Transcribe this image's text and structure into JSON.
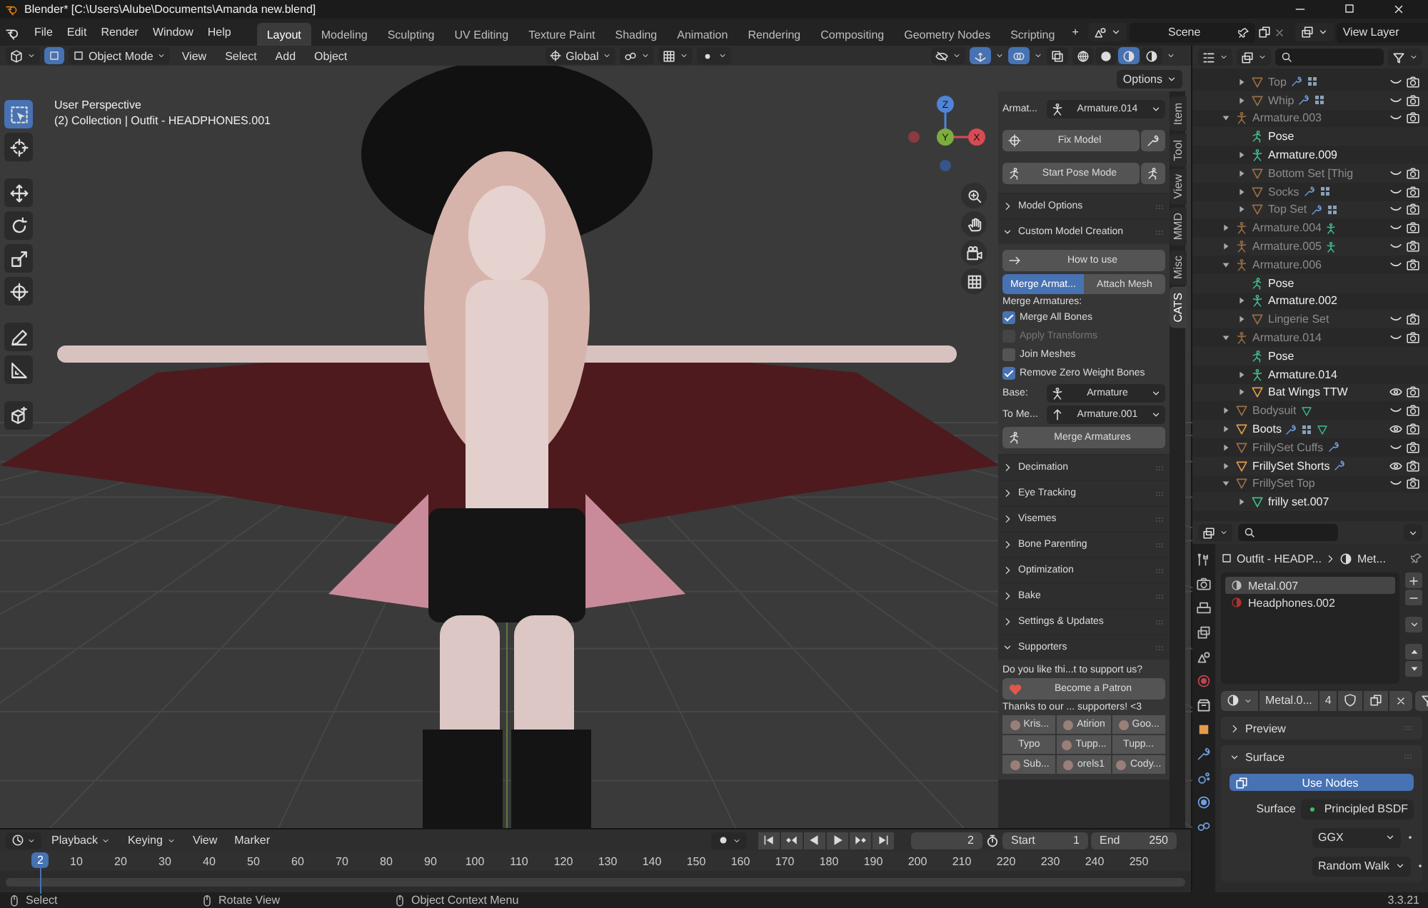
{
  "window": {
    "title": "Blender* [C:\\Users\\Alube\\Documents\\Amanda new.blend]"
  },
  "menu": [
    "File",
    "Edit",
    "Render",
    "Window",
    "Help"
  ],
  "workspaces": [
    {
      "label": "Layout",
      "selected": true
    },
    {
      "label": "Modeling",
      "selected": false
    },
    {
      "label": "Sculpting",
      "selected": false
    },
    {
      "label": "UV Editing",
      "selected": false
    },
    {
      "label": "Texture Paint",
      "selected": false
    },
    {
      "label": "Shading",
      "selected": false
    },
    {
      "label": "Animation",
      "selected": false
    },
    {
      "label": "Rendering",
      "selected": false
    },
    {
      "label": "Compositing",
      "selected": false
    },
    {
      "label": "Geometry Nodes",
      "selected": false
    },
    {
      "label": "Scripting",
      "selected": false
    }
  ],
  "add_workspace": "+",
  "scene": "Scene",
  "view_layer": "View Layer",
  "viewport": {
    "mode": "Object Mode",
    "menus": [
      "View",
      "Select",
      "Add",
      "Object"
    ],
    "orientation": "Global",
    "shading": [
      {
        "kind": "wireframe",
        "selected": false
      },
      {
        "kind": "solid",
        "selected": false
      },
      {
        "kind": "material",
        "selected": true
      },
      {
        "kind": "rendered",
        "selected": false
      }
    ],
    "overlay_text": [
      "User Perspective",
      "(2) Collection | Outfit - HEADPHONES.001"
    ],
    "axis_labels": [
      "Z",
      "Y",
      "X"
    ],
    "tools": [
      {
        "kind": "select-box",
        "selected": true
      },
      {
        "kind": "cursor",
        "selected": false
      },
      {
        "kind": "move",
        "selected": false
      },
      {
        "kind": "rotate",
        "selected": false
      },
      {
        "kind": "scale",
        "selected": false
      },
      {
        "kind": "transform",
        "selected": false
      },
      {
        "kind": "annotate",
        "selected": false
      },
      {
        "kind": "measure",
        "selected": false
      },
      {
        "kind": "add-cube",
        "selected": false
      }
    ]
  },
  "sidebar": {
    "options": "Options",
    "tabs": [
      {
        "label": "Item",
        "selected": false
      },
      {
        "label": "Tool",
        "selected": false
      },
      {
        "label": "View",
        "selected": false
      },
      {
        "label": "MMD",
        "selected": false
      },
      {
        "label": "Misc",
        "selected": false
      },
      {
        "label": "CATS",
        "selected": true
      }
    ],
    "armature_label": "Armat...",
    "armature": "Armature.014",
    "fix_model": "Fix Model",
    "start_pose_mode": "Start Pose Mode",
    "panels": [
      {
        "title": "Model Options",
        "expanded": false
      },
      {
        "kind": "custom_model",
        "title": "Custom Model Creation",
        "expanded": true,
        "how_to_use": "How to use",
        "tabs": [
          {
            "label": "Merge Armat...",
            "selected": true
          },
          {
            "label": "Attach Mesh",
            "selected": false
          }
        ],
        "section": "Merge Armatures:",
        "options": [
          {
            "label": "Merge All Bones",
            "checked": true,
            "disabled": false
          },
          {
            "label": "Apply Transforms",
            "checked": false,
            "disabled": true
          },
          {
            "label": "Join Meshes",
            "checked": false,
            "disabled": false
          },
          {
            "label": "Remove Zero Weight Bones",
            "checked": true,
            "disabled": false
          }
        ],
        "base_label": "Base:",
        "base": "Armature",
        "target_label": "To Me...",
        "target": "Armature.001",
        "action": "Merge Armatures"
      },
      {
        "title": "Decimation",
        "expanded": false
      },
      {
        "title": "Eye Tracking",
        "expanded": false
      },
      {
        "title": "Visemes",
        "expanded": false
      },
      {
        "title": "Bone Parenting",
        "expanded": false
      },
      {
        "title": "Optimization",
        "expanded": false
      },
      {
        "title": "Bake",
        "expanded": false
      },
      {
        "title": "Settings & Updates",
        "expanded": false
      },
      {
        "kind": "supporters",
        "title": "Supporters",
        "expanded": true,
        "prompt": "Do you like thi...t to support us?",
        "patron": "Become a Patron",
        "thanks": "Thanks to our ... supporters! <3",
        "supporters": [
          {
            "name": "Kris...",
            "avatar": true
          },
          {
            "name": "Atirion",
            "avatar": true
          },
          {
            "name": "Goo...",
            "avatar": true
          },
          {
            "name": "Typo",
            "avatar": false
          },
          {
            "name": "Tupp...",
            "avatar": true
          },
          {
            "name": "Tupp...",
            "avatar": false
          },
          {
            "name": "Sub...",
            "avatar": true
          },
          {
            "name": "orels1",
            "avatar": true
          },
          {
            "name": "Cody...",
            "avatar": true
          }
        ]
      }
    ]
  },
  "outliner": {
    "items": [
      {
        "kind": "continued",
        "children": [
          {
            "kind": "mesh",
            "name": "Top",
            "expanded": false,
            "visible": false,
            "extras": [
              {
                "kind": "modifier"
              },
              {
                "kind": "vertex-groups"
              }
            ]
          },
          {
            "kind": "mesh",
            "name": "Whip",
            "expanded": false,
            "visible": false,
            "extras": [
              {
                "kind": "modifier"
              },
              {
                "kind": "vertex-groups"
              }
            ]
          }
        ]
      },
      {
        "kind": "armature",
        "name": "Armature.003",
        "expanded": true,
        "visible": false,
        "children": [
          {
            "kind": "pose",
            "name": "Pose"
          },
          {
            "kind": "armature-data",
            "name": "Armature.009",
            "expanded": false
          },
          {
            "kind": "mesh",
            "name": "Bottom Set [Thig",
            "expanded": false,
            "visible": false
          },
          {
            "kind": "mesh",
            "name": "Socks",
            "expanded": false,
            "visible": false,
            "extras": [
              {
                "kind": "modifier"
              },
              {
                "kind": "vertex-groups"
              }
            ]
          },
          {
            "kind": "mesh",
            "name": "Top Set",
            "expanded": false,
            "visible": false,
            "extras": [
              {
                "kind": "modifier"
              },
              {
                "kind": "vertex-groups"
              }
            ]
          }
        ]
      },
      {
        "kind": "armature",
        "name": "Armature.004",
        "expanded": false,
        "visible": false,
        "extras": [
          {
            "kind": "armature-data"
          }
        ]
      },
      {
        "kind": "armature",
        "name": "Armature.005",
        "expanded": false,
        "visible": false,
        "extras": [
          {
            "kind": "armature-data"
          }
        ]
      },
      {
        "kind": "armature",
        "name": "Armature.006",
        "expanded": true,
        "visible": false,
        "children": [
          {
            "kind": "pose",
            "name": "Pose"
          },
          {
            "kind": "armature-data",
            "name": "Armature.002",
            "expanded": false
          },
          {
            "kind": "mesh",
            "name": "Lingerie Set",
            "expanded": false,
            "visible": false
          }
        ]
      },
      {
        "kind": "armature",
        "name": "Armature.014",
        "expanded": true,
        "visible": false,
        "children": [
          {
            "kind": "pose",
            "name": "Pose"
          },
          {
            "kind": "armature-data",
            "name": "Armature.014",
            "expanded": false
          },
          {
            "kind": "mesh",
            "name": "Bat Wings TTW",
            "expanded": false,
            "visible": true
          }
        ]
      },
      {
        "kind": "mesh",
        "name": "Bodysuit",
        "expanded": false,
        "visible": false,
        "extras": [
          {
            "kind": "mesh-data"
          }
        ]
      },
      {
        "kind": "mesh",
        "name": "Boots",
        "expanded": false,
        "visible": true,
        "extras": [
          {
            "kind": "modifier"
          },
          {
            "kind": "vertex-groups"
          },
          {
            "kind": "mesh-data"
          }
        ]
      },
      {
        "kind": "mesh",
        "name": "FrillySet Cuffs",
        "expanded": false,
        "visible": false,
        "extras": [
          {
            "kind": "modifier"
          }
        ]
      },
      {
        "kind": "mesh",
        "name": "FrillySet Shorts",
        "expanded": false,
        "visible": true,
        "extras": [
          {
            "kind": "modifier"
          }
        ]
      },
      {
        "kind": "mesh",
        "name": "FrillySet Top",
        "expanded": true,
        "visible": false,
        "children": [
          {
            "kind": "mesh-data",
            "name": "frilly set.007",
            "expanded": false
          }
        ]
      }
    ]
  },
  "properties": {
    "tabs": [
      {
        "kind": "tool"
      },
      {
        "kind": "render"
      },
      {
        "kind": "output"
      },
      {
        "kind": "view_layer"
      },
      {
        "kind": "scene"
      },
      {
        "kind": "world"
      },
      {
        "kind": "collection"
      },
      {
        "kind": "object"
      },
      {
        "kind": "modifiers"
      },
      {
        "kind": "particles"
      },
      {
        "kind": "physics"
      },
      {
        "kind": "constraints"
      }
    ],
    "breadcrumb": [
      "Outfit - HEADP...",
      "Met..."
    ],
    "slots": [
      {
        "name": "Metal.007",
        "selected": true
      },
      {
        "name": "Headphones.002",
        "selected": false
      }
    ],
    "material": "Metal.0...",
    "users": "4",
    "panels": [
      {
        "title": "Preview",
        "expanded": false
      },
      {
        "kind": "surface",
        "title": "Surface",
        "expanded": true,
        "use_nodes": "Use Nodes",
        "surface_label": "Surface",
        "shader": "Principled BSDF",
        "distribution": "GGX",
        "subsurface": "Random Walk"
      }
    ]
  },
  "timeline": {
    "menus": [
      "Playback",
      "Keying",
      "View",
      "Marker"
    ],
    "current_frame": "2",
    "start_label": "Start",
    "start": "1",
    "end_label": "End",
    "end": "250",
    "playhead": "2",
    "ruler": [
      "10",
      "20",
      "30",
      "40",
      "50",
      "60",
      "70",
      "80",
      "90",
      "100",
      "110",
      "120",
      "130",
      "140",
      "150",
      "160",
      "170",
      "180",
      "190",
      "200",
      "210",
      "220",
      "230",
      "240",
      "250"
    ]
  },
  "status_bar": {
    "hints": [
      "Select",
      "Rotate View",
      "Object Context Menu"
    ],
    "version": "3.3.21"
  }
}
